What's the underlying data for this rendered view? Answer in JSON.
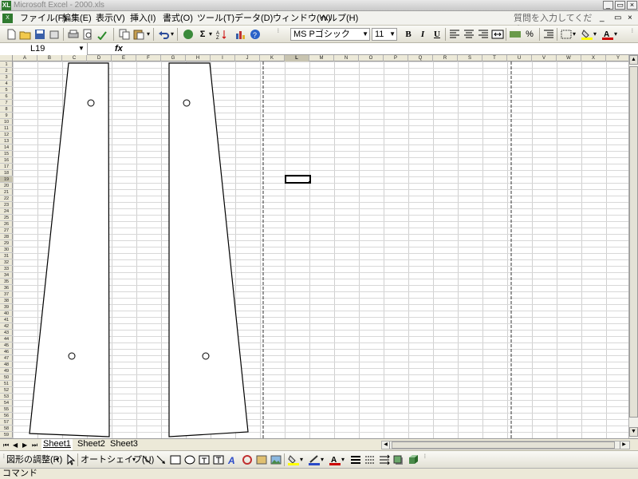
{
  "window": {
    "title": "Microsoft Excel - 2000.xls",
    "app_icon": "excel-icon",
    "minimize_label": "_",
    "restore_label": "▭",
    "close_label": "×"
  },
  "menu": {
    "items": [
      {
        "label": "ファイル(F)"
      },
      {
        "label": "編集(E)"
      },
      {
        "label": "表示(V)"
      },
      {
        "label": "挿入(I)"
      },
      {
        "label": "書式(O)"
      },
      {
        "label": "ツール(T)"
      },
      {
        "label": "データ(D)"
      },
      {
        "label": "ウィンドウ(W)"
      },
      {
        "label": "ヘルプ(H)"
      }
    ],
    "help_placeholder": "質問を入力してください",
    "doc_minimize": "_",
    "doc_restore": "▭",
    "doc_close": "×"
  },
  "toolbar": {
    "font_name": "MS Pゴシック",
    "font_size": "11",
    "bold": "B",
    "italic": "I",
    "underline": "U",
    "sum_label": "Σ"
  },
  "formula_bar": {
    "name_box": "L19",
    "fx": "fx",
    "formula": ""
  },
  "sheet": {
    "columns": [
      "A",
      "B",
      "C",
      "D",
      "E",
      "F",
      "G",
      "H",
      "I",
      "J",
      "K",
      "L",
      "M",
      "N",
      "O",
      "P",
      "Q",
      "R",
      "S",
      "T",
      "U",
      "V",
      "W",
      "X",
      "Y"
    ],
    "row_count": 59,
    "selected_cell": "L19",
    "selected_column": "L",
    "selected_row": "19"
  },
  "tabs": {
    "sheets": [
      "Sheet1",
      "Sheet2",
      "Sheet3"
    ],
    "active": "Sheet1"
  },
  "draw_toolbar": {
    "draw_menu": "図形の調整(R)",
    "autoshape_menu": "オートシェイプ(U)"
  },
  "status": {
    "text": "コマンド"
  },
  "colors": {
    "accent_font": "#cc0000",
    "fill_yellow": "#ffff00",
    "selection_border": "#000000"
  }
}
